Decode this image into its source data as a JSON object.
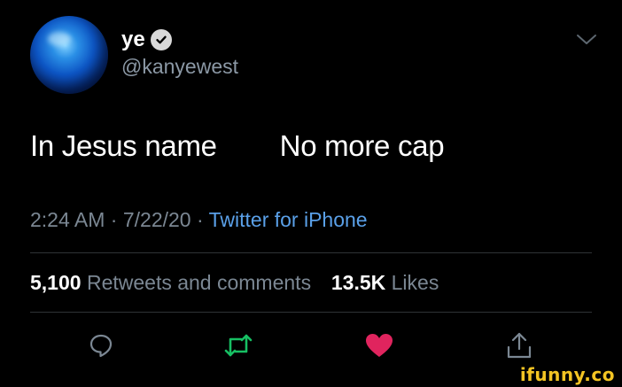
{
  "author": {
    "display_name": "ye",
    "handle": "@kanyewest"
  },
  "tweet": {
    "text": "In Jesus name        No more cap",
    "time": "2:24 AM",
    "date": "7/22/20",
    "source": "Twitter for iPhone"
  },
  "stats": {
    "retweets_count": "5,100",
    "retweets_label": "Retweets and comments",
    "likes_count": "13.5K",
    "likes_label": "Likes"
  },
  "icons": {
    "reply": "reply-icon",
    "retweet": "retweet-icon",
    "like": "heart-icon",
    "share": "share-icon",
    "menu": "chevron-down-icon",
    "verified": "verified-badge-icon"
  },
  "colors": {
    "retweet": "#17bf63",
    "like": "#e0245e",
    "link": "#5aa0e8",
    "muted": "#7b8793"
  },
  "watermark": "ifunny.co"
}
